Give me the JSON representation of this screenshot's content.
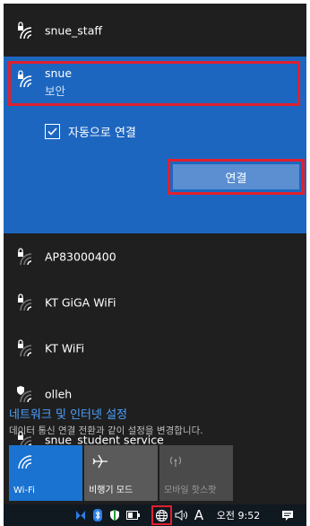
{
  "networks": [
    {
      "name": "snue_staff",
      "secured": true
    },
    {
      "name": "AP83000400",
      "secured": true
    },
    {
      "name": "KT GiGA WiFi",
      "secured": true
    },
    {
      "name": "KT WiFi",
      "secured": true
    },
    {
      "name": "olleh",
      "secured": "shield"
    },
    {
      "name": "snue_student service",
      "secured": true
    }
  ],
  "selected": {
    "name": "snue",
    "security": "보안",
    "auto_connect_label": "자동으로 연결",
    "auto_connect_checked": true,
    "connect_label": "연결"
  },
  "settings": {
    "link": "네트워크 및 인터넷 설정",
    "description": "데이터 통신 연결 전환과 같이 설정을 변경합니다."
  },
  "tiles": [
    {
      "label": "Wi-Fi",
      "state": "on",
      "icon": "wifi-icon"
    },
    {
      "label": "비행기 모드",
      "state": "off",
      "icon": "airplane-icon"
    },
    {
      "label": "모바일 핫스팟",
      "state": "disabled",
      "icon": "hotspot-icon"
    }
  ],
  "taskbar": {
    "ime": "A",
    "clock": "오전 9:52"
  },
  "colors": {
    "panel_bg": "#1f1f1f",
    "selected_bg": "#1d66c0",
    "highlight": "#e0202e",
    "link": "#4aa0ff"
  }
}
